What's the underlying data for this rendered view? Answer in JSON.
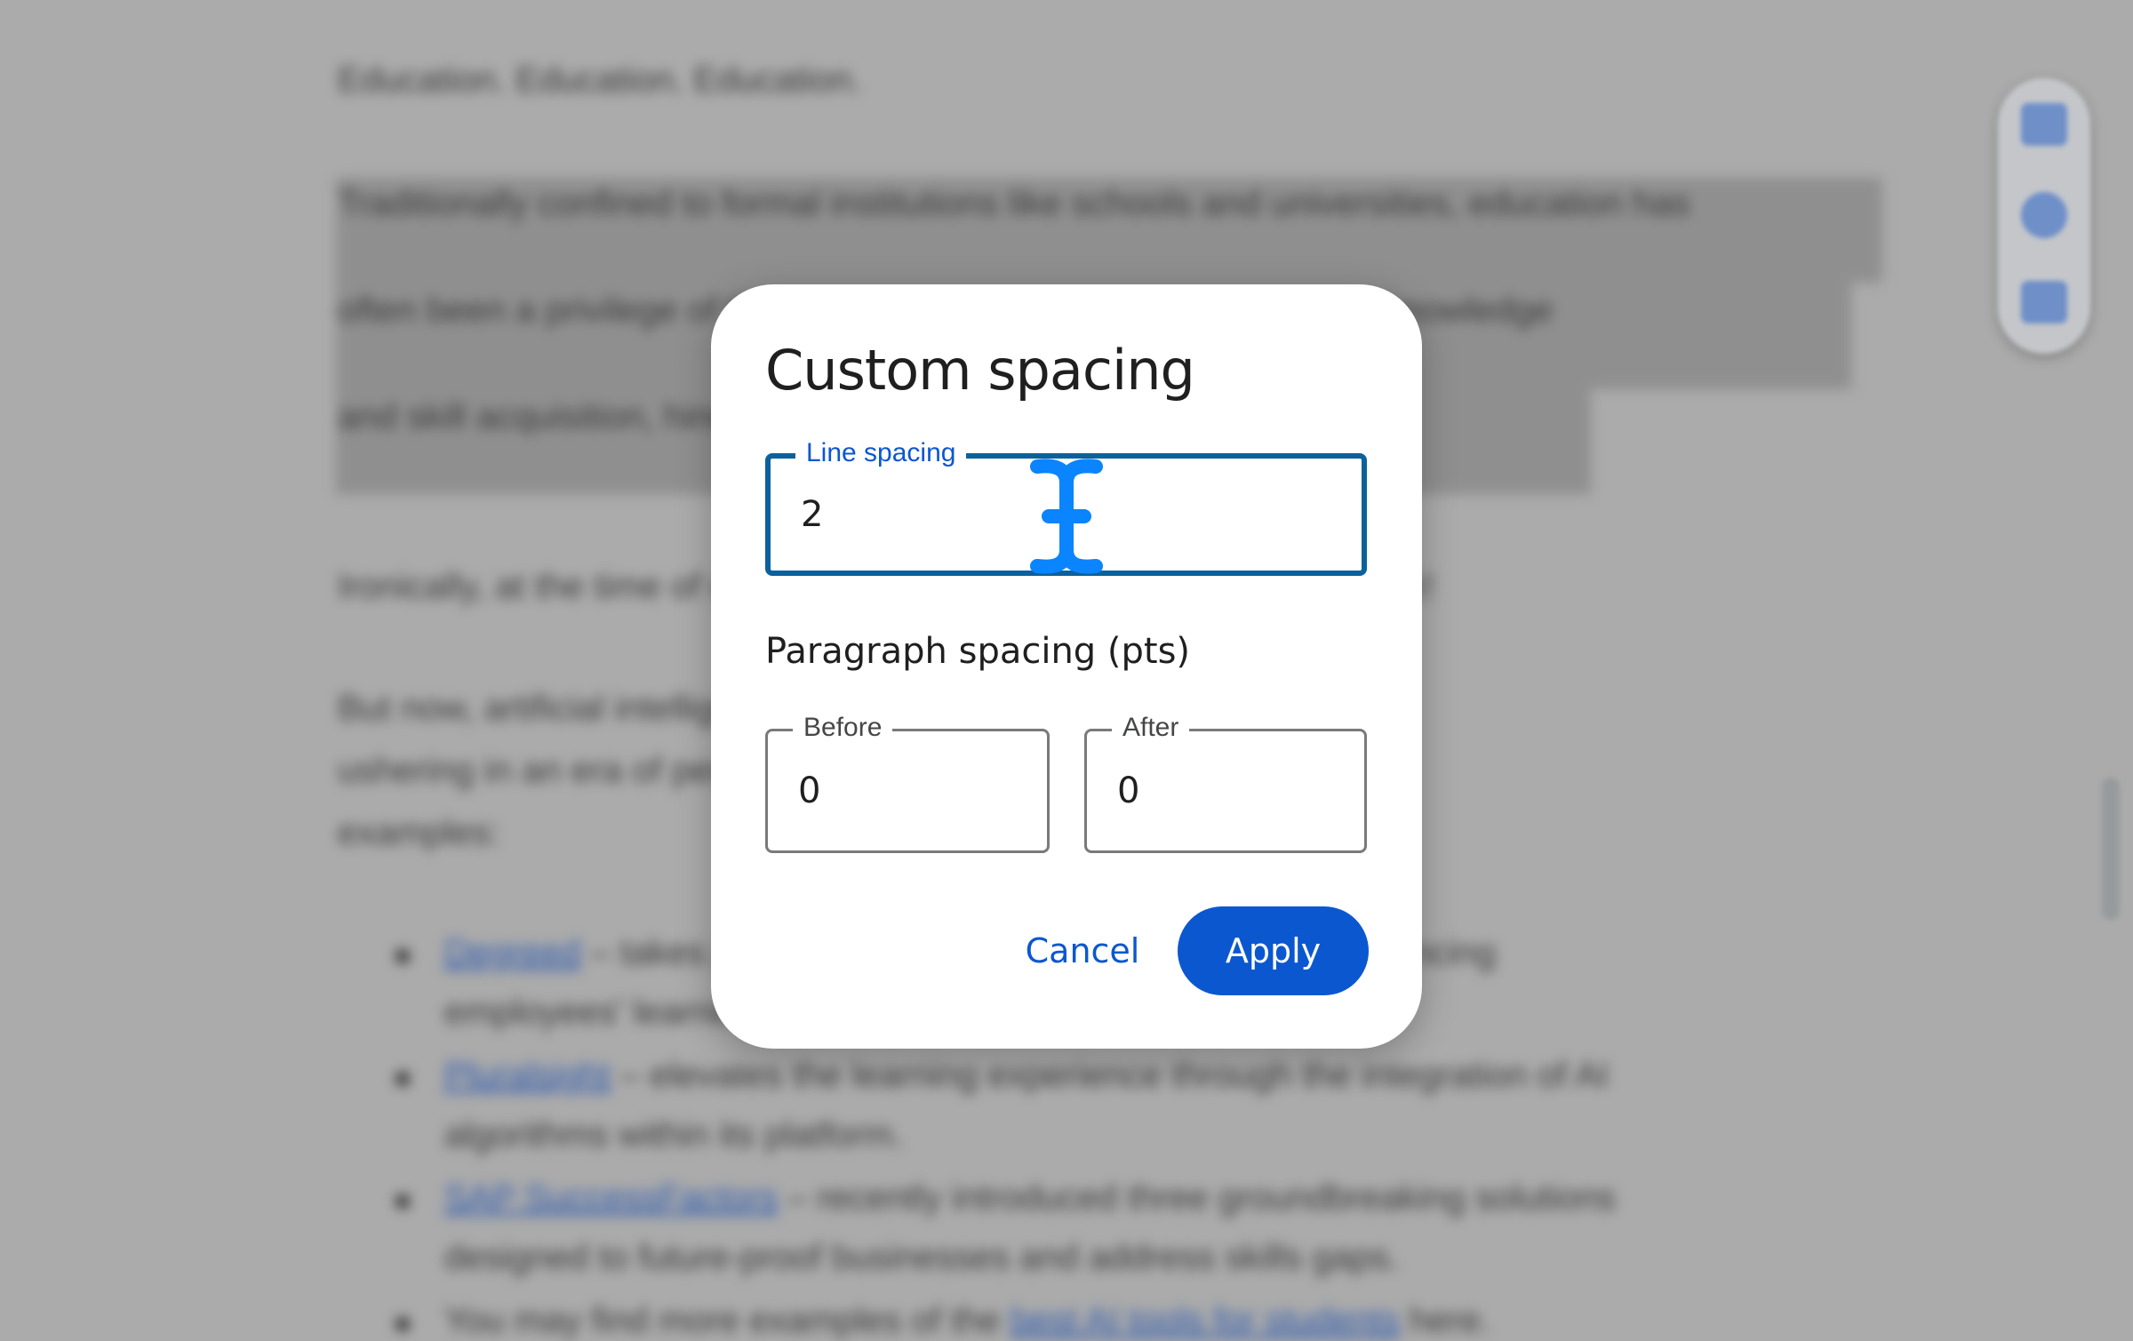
{
  "document": {
    "heading_line": "Education. Education. Education.",
    "highlighted_paragraph": [
      "Traditionally confined to formal institutions like schools and universities, education has",
      "often been a privilege of the few, which has resulted in a chasm in knowledge",
      "and skill acquisition, hindering societal and economic progress."
    ],
    "paragraph_2": "Ironically, at the time of writing, it's also International Education Week!",
    "paragraph_3": [
      "But now, artificial intelligence is democratizing education and",
      "ushering in an era of personalized learning. Here are some popular",
      "examples:"
    ],
    "list_items": [
      {
        "link": "Degreed",
        "text": " – takes personalized learning to the next level, enhancing",
        "cont": "employees' learning experiences."
      },
      {
        "link": "Pluralsight",
        "text": " – elevates the learning experience through the integration of AI",
        "cont": "algorithms within its platform."
      },
      {
        "link": "SAP SuccessFactors",
        "text": " – recently introduced three groundbreaking solutions",
        "cont": "designed to future-proof businesses and address skills gaps."
      },
      {
        "prefix": "You may find more examples of the ",
        "link": "best AI tools for students",
        "text": " here."
      }
    ]
  },
  "side_actions": {
    "icons": [
      "add-comment-icon",
      "add-emoji-reaction-icon",
      "suggest-edits-icon"
    ]
  },
  "dialog": {
    "title": "Custom spacing",
    "line_spacing": {
      "label": "Line spacing",
      "value": "2"
    },
    "paragraph_section_title": "Paragraph spacing (pts)",
    "before": {
      "label": "Before",
      "value": "0"
    },
    "after": {
      "label": "After",
      "value": "0"
    },
    "cancel_label": "Cancel",
    "apply_label": "Apply"
  },
  "colors": {
    "accent": "#0b57d0",
    "focused_border": "#0b619c",
    "cursor": "#0a84ff",
    "scrim": "#ababab"
  }
}
